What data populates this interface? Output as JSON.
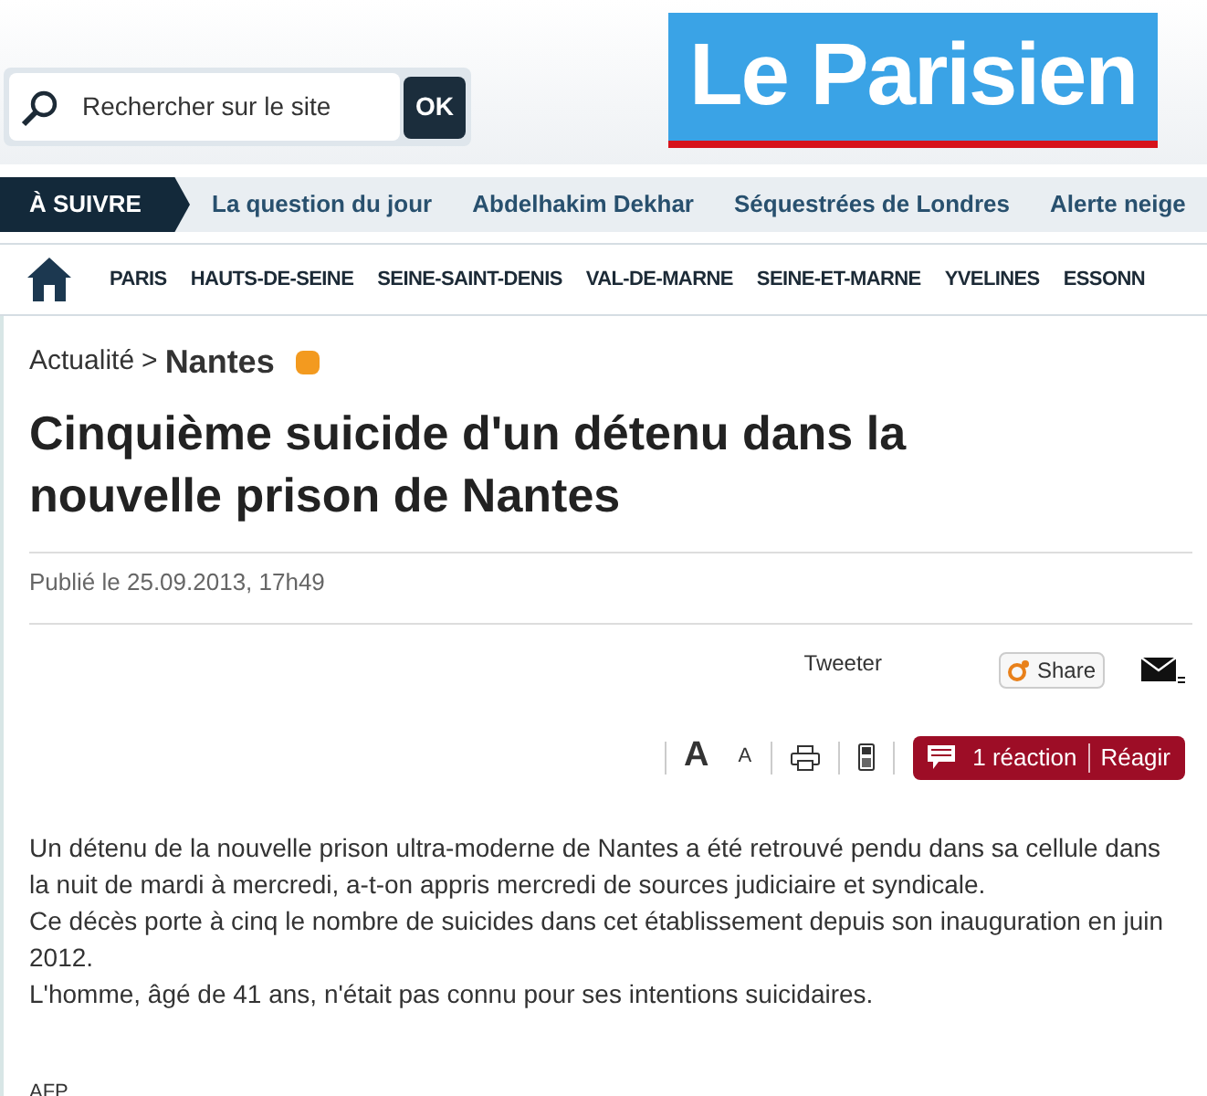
{
  "search": {
    "placeholder": "Rechercher sur le site",
    "button": "OK"
  },
  "logo": {
    "text": "Le Parisien"
  },
  "a_suivre": {
    "label": "À SUIVRE",
    "links": [
      "La question du jour",
      "Abdelhakim Dekhar",
      "Séquestrées de Londres",
      "Alerte neige"
    ]
  },
  "regions": [
    "PARIS",
    "HAUTS-DE-SEINE",
    "SEINE-SAINT-DENIS",
    "VAL-DE-MARNE",
    "SEINE-ET-MARNE",
    "YVELINES",
    "ESSONN"
  ],
  "breadcrumb": {
    "parent": "Actualité",
    "separator": ">",
    "current": "Nantes"
  },
  "title": "Cinquième suicide d'un détenu dans la nouvelle prison de Nantes",
  "published": "Publié le 25.09.2013, 17h49",
  "share": {
    "tweet": "Tweeter",
    "share": "Share"
  },
  "tools": {
    "font_large": "A",
    "font_small": "A",
    "reactions": "1 réaction",
    "react": "Réagir"
  },
  "paragraphs": [
    "Un détenu de la nouvelle prison ultra-moderne de Nantes a été retrouvé pendu dans sa cellule dans la nuit de mardi à mercredi, a-t-on appris mercredi de sources judiciaire et syndicale.",
    "Ce décès porte à cinq le nombre de suicides dans cet établissement depuis son inauguration en juin 2012.",
    "L'homme, âgé de 41 ans, n'était pas connu pour ses intentions suicidaires."
  ],
  "source": "AFP"
}
